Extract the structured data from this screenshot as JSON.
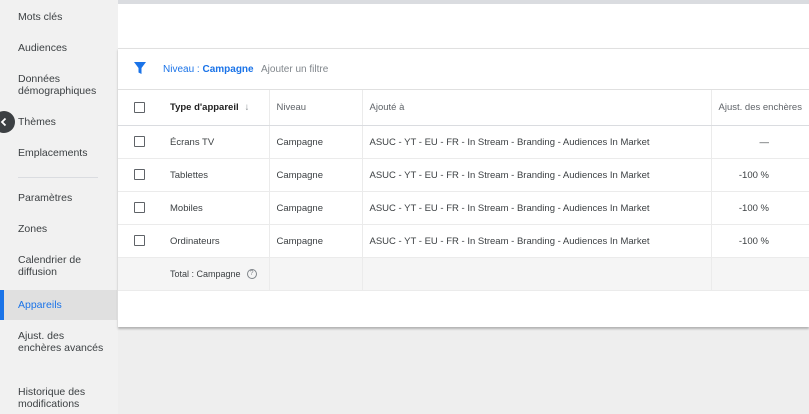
{
  "sidebar": {
    "items": [
      {
        "label": "Mots clés"
      },
      {
        "label": "Audiences"
      },
      {
        "label": "Données démographiques"
      },
      {
        "label": "Thèmes"
      },
      {
        "label": "Emplacements"
      },
      {
        "label": "Paramètres"
      },
      {
        "label": "Zones"
      },
      {
        "label": "Calendrier de diffusion"
      },
      {
        "label": "Appareils"
      },
      {
        "label": "Ajust. des enchères avancés"
      },
      {
        "label": "Historique des modifications"
      }
    ]
  },
  "filter": {
    "chip_prefix": "Niveau : ",
    "chip_value": "Campagne",
    "add_label": "Ajouter un filtre"
  },
  "table": {
    "headers": {
      "type": "Type d'appareil",
      "level": "Niveau",
      "added": "Ajouté à",
      "adjustment": "Ajust. des enchères"
    },
    "rows": [
      {
        "type": "Écrans TV",
        "level": "Campagne",
        "added": "ASUC - YT - EU - FR - In Stream - Branding - Audiences In Market",
        "adjustment": "—"
      },
      {
        "type": "Tablettes",
        "level": "Campagne",
        "added": "ASUC - YT - EU - FR - In Stream - Branding - Audiences In Market",
        "adjustment": "-100 %"
      },
      {
        "type": "Mobiles",
        "level": "Campagne",
        "added": "ASUC - YT - EU - FR - In Stream - Branding - Audiences In Market",
        "adjustment": "-100 %"
      },
      {
        "type": "Ordinateurs",
        "level": "Campagne",
        "added": "ASUC - YT - EU - FR - In Stream - Branding - Audiences In Market",
        "adjustment": "-100 %"
      }
    ],
    "total_label": "Total : Campagne"
  },
  "colors": {
    "accent": "#1a73e8",
    "sidebar_bg": "#f1f1f1",
    "active_bg": "#e0e0e0"
  }
}
